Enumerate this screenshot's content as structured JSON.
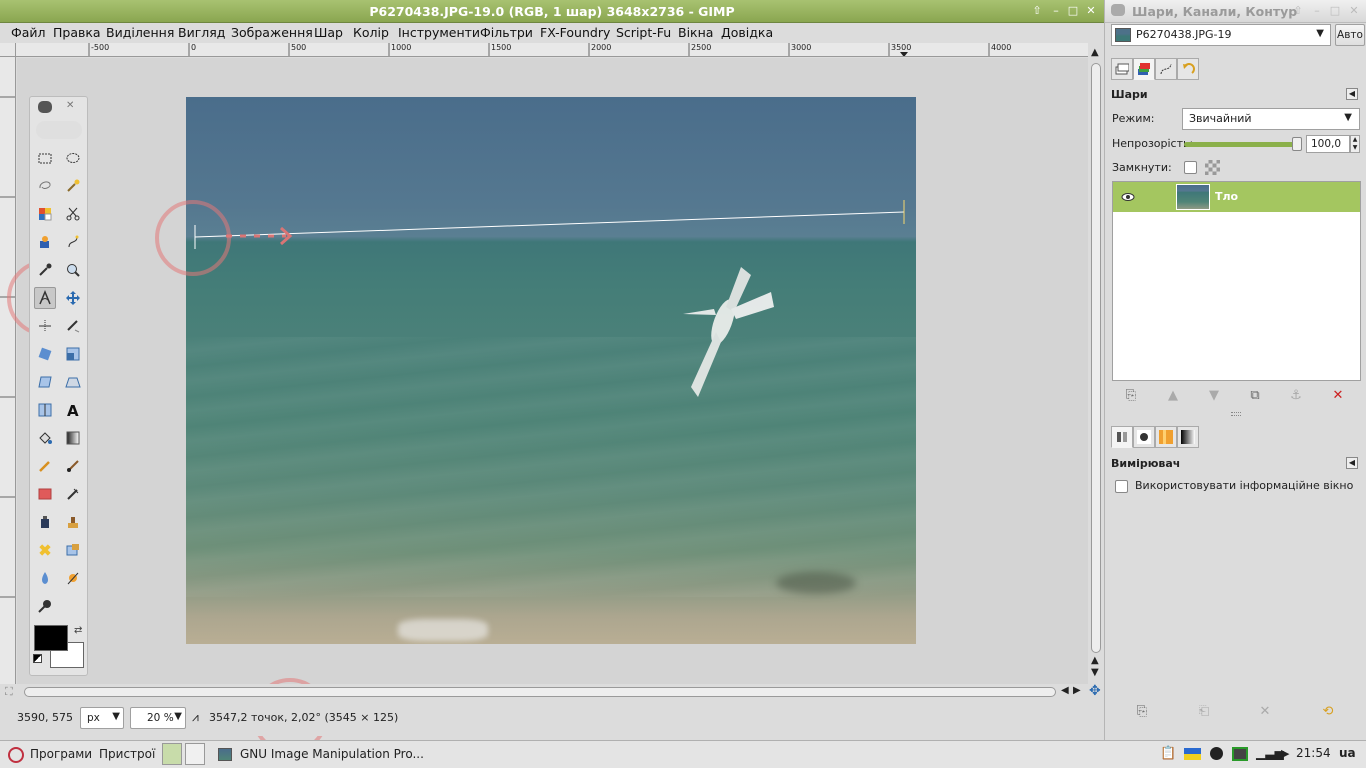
{
  "main_window": {
    "title": "P6270438.JPG-19.0 (RGB, 1 шар) 3648x2736 - GIMP",
    "controls": [
      "⇧",
      "–",
      "□",
      "✕"
    ]
  },
  "menu": [
    "Файл",
    "Правка",
    "Виділення",
    "Вигляд",
    "Зображення",
    "Шар",
    "Колір",
    "Інструменти",
    "Фільтри",
    "FX-Foundry",
    "Script-Fu",
    "Вікна",
    "Довідка"
  ],
  "ruler": {
    "top_ticks": [
      "-500",
      "0",
      "500",
      "1000",
      "1500",
      "2000",
      "2500",
      "3000",
      "3500",
      "4000"
    ]
  },
  "toolbox": {
    "active_tool": "measure-tool"
  },
  "statusbar": {
    "coords": "3590, 575",
    "unit": "px",
    "zoom": "20 %",
    "message": "3547,2 точок, 2,02° (3545 × 125)"
  },
  "dock": {
    "title": "Шари, Канали, Контур",
    "image_select": "P6270438.JPG-19",
    "auto_button": "Авто",
    "layers_panel": {
      "heading": "Шари",
      "mode_label": "Режим:",
      "mode_value": "Звичайний",
      "opacity_label": "Непрозорість:",
      "opacity_value": "100,0",
      "opacity": 1.0,
      "lock_label": "Замкнути:",
      "layers": [
        {
          "name": "Тло",
          "visible": true,
          "selected": true
        }
      ]
    },
    "tool_options": {
      "heading": "Вимірювач",
      "use_info_window_label": "Використовувати інформаційне вікно",
      "use_info_window": false
    }
  },
  "taskbar": {
    "programs": "Програми",
    "devices": "Пристрої",
    "app_button": "GNU Image Manipulation Pro...",
    "clock": "21:54",
    "lang": "ua"
  },
  "colors": {
    "title_green": "#8aa650",
    "selection_green": "#a4c660",
    "annotation": "#e07878",
    "fg_color": "#000000",
    "bg_color": "#ffffff"
  }
}
